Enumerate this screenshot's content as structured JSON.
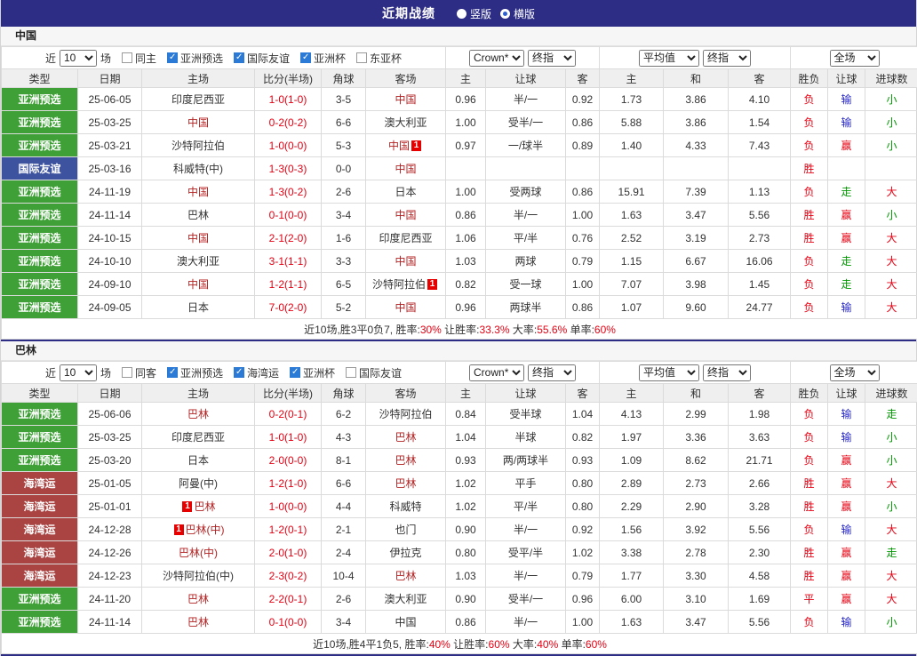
{
  "topbar": {
    "title": "近期战绩",
    "options": [
      {
        "label": "竖版",
        "selected": false
      },
      {
        "label": "横版",
        "selected": true
      }
    ]
  },
  "columns": [
    "类型",
    "日期",
    "主场",
    "比分(半场)",
    "角球",
    "客场",
    "主",
    "让球",
    "客",
    "主",
    "和",
    "客",
    "胜负",
    "让球",
    "进球数"
  ],
  "colors": {
    "topbar_bg": "#2D2D86",
    "type_badges": {
      "亚洲预选": "#3FA037",
      "国际友谊": "#3E53A0",
      "海湾运": "#A94442"
    },
    "score": "#E60012",
    "focus_team": "#B22222",
    "results": {
      "red": "#E60012",
      "blue": "#2424C9",
      "green": "#009900"
    }
  },
  "sections": [
    {
      "title": "中国",
      "filter": {
        "near_label": "近",
        "count": "10",
        "matches_label": "场",
        "checkboxes": [
          {
            "label": "同主",
            "checked": false
          },
          {
            "label": "亚洲预选",
            "checked": true
          },
          {
            "label": "国际友谊",
            "checked": true
          },
          {
            "label": "亚洲杯",
            "checked": true
          },
          {
            "label": "东亚杯",
            "checked": false
          }
        ]
      },
      "selects": {
        "bookmaker": "Crown*",
        "asian_time": "终指",
        "euro_value": "平均值",
        "euro_time": "终指",
        "scope": "全场"
      },
      "rows": [
        {
          "type": "亚洲预选",
          "date": "25-06-05",
          "home": {
            "name": "印度尼西亚"
          },
          "score": "1-0(1-0)",
          "corners": "3-5",
          "away": {
            "name": "中国",
            "focus": true
          },
          "asian": [
            "0.96",
            "半/一",
            "0.92"
          ],
          "euro": [
            "1.73",
            "3.86",
            "4.10"
          ],
          "results": [
            {
              "t": "负",
              "c": "red"
            },
            {
              "t": "输",
              "c": "blue"
            },
            {
              "t": "小",
              "c": "green"
            }
          ]
        },
        {
          "type": "亚洲预选",
          "date": "25-03-25",
          "home": {
            "name": "中国",
            "focus": true
          },
          "score": "0-2(0-2)",
          "corners": "6-6",
          "away": {
            "name": "澳大利亚"
          },
          "asian": [
            "1.00",
            "受半/一",
            "0.86"
          ],
          "euro": [
            "5.88",
            "3.86",
            "1.54"
          ],
          "results": [
            {
              "t": "负",
              "c": "red"
            },
            {
              "t": "输",
              "c": "blue"
            },
            {
              "t": "小",
              "c": "green"
            }
          ]
        },
        {
          "type": "亚洲预选",
          "date": "25-03-21",
          "home": {
            "name": "沙特阿拉伯"
          },
          "score": "1-0(0-0)",
          "corners": "5-3",
          "away": {
            "name": "中国",
            "focus": true,
            "card": "1",
            "card_pos": "after"
          },
          "asian": [
            "0.97",
            "一/球半",
            "0.89"
          ],
          "euro": [
            "1.40",
            "4.33",
            "7.43"
          ],
          "results": [
            {
              "t": "负",
              "c": "red"
            },
            {
              "t": "赢",
              "c": "red"
            },
            {
              "t": "小",
              "c": "green"
            }
          ]
        },
        {
          "type": "国际友谊",
          "date": "25-03-16",
          "home": {
            "name": "科威特(中)"
          },
          "score": "1-3(0-3)",
          "corners": "0-0",
          "away": {
            "name": "中国",
            "focus": true
          },
          "asian": [
            "",
            "",
            ""
          ],
          "euro": [
            "",
            "",
            ""
          ],
          "results": [
            {
              "t": "胜",
              "c": "red"
            },
            {
              "t": "",
              "c": ""
            },
            {
              "t": "",
              "c": ""
            }
          ]
        },
        {
          "type": "亚洲预选",
          "date": "24-11-19",
          "home": {
            "name": "中国",
            "focus": true
          },
          "score": "1-3(0-2)",
          "corners": "2-6",
          "away": {
            "name": "日本"
          },
          "asian": [
            "1.00",
            "受两球",
            "0.86"
          ],
          "euro": [
            "15.91",
            "7.39",
            "1.13"
          ],
          "results": [
            {
              "t": "负",
              "c": "red"
            },
            {
              "t": "走",
              "c": "green"
            },
            {
              "t": "大",
              "c": "red"
            }
          ]
        },
        {
          "type": "亚洲预选",
          "date": "24-11-14",
          "home": {
            "name": "巴林"
          },
          "score": "0-1(0-0)",
          "corners": "3-4",
          "away": {
            "name": "中国",
            "focus": true
          },
          "asian": [
            "0.86",
            "半/一",
            "1.00"
          ],
          "euro": [
            "1.63",
            "3.47",
            "5.56"
          ],
          "results": [
            {
              "t": "胜",
              "c": "red"
            },
            {
              "t": "赢",
              "c": "red"
            },
            {
              "t": "小",
              "c": "green"
            }
          ]
        },
        {
          "type": "亚洲预选",
          "date": "24-10-15",
          "home": {
            "name": "中国",
            "focus": true
          },
          "score": "2-1(2-0)",
          "corners": "1-6",
          "away": {
            "name": "印度尼西亚"
          },
          "asian": [
            "1.06",
            "平/半",
            "0.76"
          ],
          "euro": [
            "2.52",
            "3.19",
            "2.73"
          ],
          "results": [
            {
              "t": "胜",
              "c": "red"
            },
            {
              "t": "赢",
              "c": "red"
            },
            {
              "t": "大",
              "c": "red"
            }
          ]
        },
        {
          "type": "亚洲预选",
          "date": "24-10-10",
          "home": {
            "name": "澳大利亚"
          },
          "score": "3-1(1-1)",
          "corners": "3-3",
          "away": {
            "name": "中国",
            "focus": true
          },
          "asian": [
            "1.03",
            "两球",
            "0.79"
          ],
          "euro": [
            "1.15",
            "6.67",
            "16.06"
          ],
          "results": [
            {
              "t": "负",
              "c": "red"
            },
            {
              "t": "走",
              "c": "green"
            },
            {
              "t": "大",
              "c": "red"
            }
          ]
        },
        {
          "type": "亚洲预选",
          "date": "24-09-10",
          "home": {
            "name": "中国",
            "focus": true
          },
          "score": "1-2(1-1)",
          "corners": "6-5",
          "away": {
            "name": "沙特阿拉伯",
            "card": "1",
            "card_pos": "after"
          },
          "asian": [
            "0.82",
            "受一球",
            "1.00"
          ],
          "euro": [
            "7.07",
            "3.98",
            "1.45"
          ],
          "results": [
            {
              "t": "负",
              "c": "red"
            },
            {
              "t": "走",
              "c": "green"
            },
            {
              "t": "大",
              "c": "red"
            }
          ]
        },
        {
          "type": "亚洲预选",
          "date": "24-09-05",
          "home": {
            "name": "日本"
          },
          "score": "7-0(2-0)",
          "corners": "5-2",
          "away": {
            "name": "中国",
            "focus": true
          },
          "asian": [
            "0.96",
            "两球半",
            "0.86"
          ],
          "euro": [
            "1.07",
            "9.60",
            "24.77"
          ],
          "results": [
            {
              "t": "负",
              "c": "red"
            },
            {
              "t": "输",
              "c": "blue"
            },
            {
              "t": "大",
              "c": "red"
            }
          ]
        }
      ],
      "summary": [
        {
          "text": "近10场,胜3平0负7, ",
          "red": false
        },
        {
          "text": "胜率:",
          "red": false
        },
        {
          "text": "30%",
          "red": true
        },
        {
          "text": " 让胜率:",
          "red": false
        },
        {
          "text": "33.3%",
          "red": true
        },
        {
          "text": " 大率:",
          "red": false
        },
        {
          "text": "55.6%",
          "red": true
        },
        {
          "text": " 单率:",
          "red": false
        },
        {
          "text": "60%",
          "red": true
        }
      ]
    },
    {
      "title": "巴林",
      "filter": {
        "near_label": "近",
        "count": "10",
        "matches_label": "场",
        "checkboxes": [
          {
            "label": "同客",
            "checked": false
          },
          {
            "label": "亚洲预选",
            "checked": true
          },
          {
            "label": "海湾运",
            "checked": true
          },
          {
            "label": "亚洲杯",
            "checked": true
          },
          {
            "label": "国际友谊",
            "checked": false
          }
        ]
      },
      "selects": {
        "bookmaker": "Crown*",
        "asian_time": "终指",
        "euro_value": "平均值",
        "euro_time": "终指",
        "scope": "全场"
      },
      "rows": [
        {
          "type": "亚洲预选",
          "date": "25-06-06",
          "home": {
            "name": "巴林",
            "focus": true
          },
          "score": "0-2(0-1)",
          "corners": "6-2",
          "away": {
            "name": "沙特阿拉伯"
          },
          "asian": [
            "0.84",
            "受半球",
            "1.04"
          ],
          "euro": [
            "4.13",
            "2.99",
            "1.98"
          ],
          "results": [
            {
              "t": "负",
              "c": "red"
            },
            {
              "t": "输",
              "c": "blue"
            },
            {
              "t": "走",
              "c": "green"
            }
          ]
        },
        {
          "type": "亚洲预选",
          "date": "25-03-25",
          "home": {
            "name": "印度尼西亚"
          },
          "score": "1-0(1-0)",
          "corners": "4-3",
          "away": {
            "name": "巴林",
            "focus": true
          },
          "asian": [
            "1.04",
            "半球",
            "0.82"
          ],
          "euro": [
            "1.97",
            "3.36",
            "3.63"
          ],
          "results": [
            {
              "t": "负",
              "c": "red"
            },
            {
              "t": "输",
              "c": "blue"
            },
            {
              "t": "小",
              "c": "green"
            }
          ]
        },
        {
          "type": "亚洲预选",
          "date": "25-03-20",
          "home": {
            "name": "日本"
          },
          "score": "2-0(0-0)",
          "corners": "8-1",
          "away": {
            "name": "巴林",
            "focus": true
          },
          "asian": [
            "0.93",
            "两/两球半",
            "0.93"
          ],
          "euro": [
            "1.09",
            "8.62",
            "21.71"
          ],
          "results": [
            {
              "t": "负",
              "c": "red"
            },
            {
              "t": "赢",
              "c": "red"
            },
            {
              "t": "小",
              "c": "green"
            }
          ]
        },
        {
          "type": "海湾运",
          "date": "25-01-05",
          "home": {
            "name": "阿曼(中)"
          },
          "score": "1-2(1-0)",
          "corners": "6-6",
          "away": {
            "name": "巴林",
            "focus": true
          },
          "asian": [
            "1.02",
            "平手",
            "0.80"
          ],
          "euro": [
            "2.89",
            "2.73",
            "2.66"
          ],
          "results": [
            {
              "t": "胜",
              "c": "red"
            },
            {
              "t": "赢",
              "c": "red"
            },
            {
              "t": "大",
              "c": "red"
            }
          ]
        },
        {
          "type": "海湾运",
          "date": "25-01-01",
          "home": {
            "name": "巴林",
            "focus": true,
            "card": "1",
            "card_pos": "before"
          },
          "score": "1-0(0-0)",
          "corners": "4-4",
          "away": {
            "name": "科威特"
          },
          "asian": [
            "1.02",
            "平/半",
            "0.80"
          ],
          "euro": [
            "2.29",
            "2.90",
            "3.28"
          ],
          "results": [
            {
              "t": "胜",
              "c": "red"
            },
            {
              "t": "赢",
              "c": "red"
            },
            {
              "t": "小",
              "c": "green"
            }
          ]
        },
        {
          "type": "海湾运",
          "date": "24-12-28",
          "home": {
            "name": "巴林(中)",
            "focus": true,
            "card": "1",
            "card_pos": "before"
          },
          "score": "1-2(0-1)",
          "corners": "2-1",
          "away": {
            "name": "也门"
          },
          "asian": [
            "0.90",
            "半/一",
            "0.92"
          ],
          "euro": [
            "1.56",
            "3.92",
            "5.56"
          ],
          "results": [
            {
              "t": "负",
              "c": "red"
            },
            {
              "t": "输",
              "c": "blue"
            },
            {
              "t": "大",
              "c": "red"
            }
          ]
        },
        {
          "type": "海湾运",
          "date": "24-12-26",
          "home": {
            "name": "巴林(中)",
            "focus": true
          },
          "score": "2-0(1-0)",
          "corners": "2-4",
          "away": {
            "name": "伊拉克"
          },
          "asian": [
            "0.80",
            "受平/半",
            "1.02"
          ],
          "euro": [
            "3.38",
            "2.78",
            "2.30"
          ],
          "results": [
            {
              "t": "胜",
              "c": "red"
            },
            {
              "t": "赢",
              "c": "red"
            },
            {
              "t": "走",
              "c": "green"
            }
          ]
        },
        {
          "type": "海湾运",
          "date": "24-12-23",
          "home": {
            "name": "沙特阿拉伯(中)"
          },
          "score": "2-3(0-2)",
          "corners": "10-4",
          "away": {
            "name": "巴林",
            "focus": true
          },
          "asian": [
            "1.03",
            "半/一",
            "0.79"
          ],
          "euro": [
            "1.77",
            "3.30",
            "4.58"
          ],
          "results": [
            {
              "t": "胜",
              "c": "red"
            },
            {
              "t": "赢",
              "c": "red"
            },
            {
              "t": "大",
              "c": "red"
            }
          ]
        },
        {
          "type": "亚洲预选",
          "date": "24-11-20",
          "home": {
            "name": "巴林",
            "focus": true
          },
          "score": "2-2(0-1)",
          "corners": "2-6",
          "away": {
            "name": "澳大利亚"
          },
          "asian": [
            "0.90",
            "受半/一",
            "0.96"
          ],
          "euro": [
            "6.00",
            "3.10",
            "1.69"
          ],
          "results": [
            {
              "t": "平",
              "c": "red"
            },
            {
              "t": "赢",
              "c": "red"
            },
            {
              "t": "大",
              "c": "red"
            }
          ]
        },
        {
          "type": "亚洲预选",
          "date": "24-11-14",
          "home": {
            "name": "巴林",
            "focus": true
          },
          "score": "0-1(0-0)",
          "corners": "3-4",
          "away": {
            "name": "中国"
          },
          "asian": [
            "0.86",
            "半/一",
            "1.00"
          ],
          "euro": [
            "1.63",
            "3.47",
            "5.56"
          ],
          "results": [
            {
              "t": "负",
              "c": "red"
            },
            {
              "t": "输",
              "c": "blue"
            },
            {
              "t": "小",
              "c": "green"
            }
          ]
        }
      ],
      "summary": [
        {
          "text": "近10场,胜4平1负5, ",
          "red": false
        },
        {
          "text": "胜率:",
          "red": false
        },
        {
          "text": "40%",
          "red": true
        },
        {
          "text": " 让胜率:",
          "red": false
        },
        {
          "text": "60%",
          "red": true
        },
        {
          "text": " 大率:",
          "red": false
        },
        {
          "text": "40%",
          "red": true
        },
        {
          "text": " 单率:",
          "red": false
        },
        {
          "text": "60%",
          "red": true
        }
      ]
    }
  ]
}
